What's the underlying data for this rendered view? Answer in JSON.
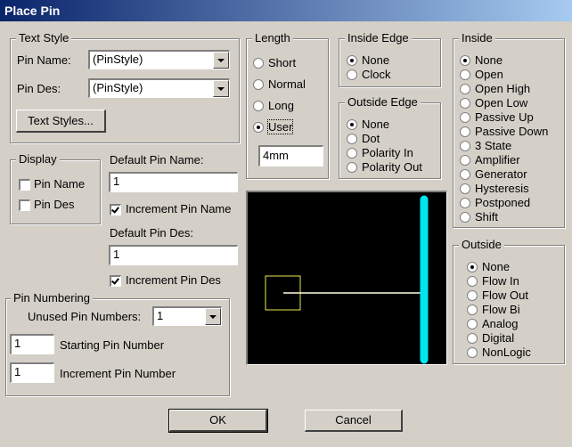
{
  "window": {
    "title": "Place Pin"
  },
  "text_style": {
    "legend": "Text Style",
    "pin_name_label": "Pin Name:",
    "pin_name_value": "(PinStyle)",
    "pin_des_label": "Pin Des:",
    "pin_des_value": "(PinStyle)",
    "text_styles_button": "Text Styles..."
  },
  "display": {
    "legend": "Display",
    "pin_name": {
      "label": "Pin Name",
      "checked": false
    },
    "pin_des": {
      "label": "Pin Des",
      "checked": false
    }
  },
  "defaults": {
    "default_pin_name_label": "Default Pin Name:",
    "default_pin_name_value": "1",
    "increment_pin_name": {
      "label": "Increment Pin Name",
      "checked": true
    },
    "default_pin_des_label": "Default Pin Des:",
    "default_pin_des_value": "1",
    "increment_pin_des": {
      "label": "Increment Pin Des",
      "checked": true
    }
  },
  "pin_numbering": {
    "legend": "Pin Numbering",
    "unused_label": "Unused Pin Numbers:",
    "unused_value": "1",
    "starting_value": "1",
    "starting_label": "Starting Pin Number",
    "increment_value": "1",
    "increment_label": "Increment Pin Number"
  },
  "length": {
    "legend": "Length",
    "options": [
      "Short",
      "Normal",
      "Long",
      "User"
    ],
    "selected": "User",
    "user_value": "4mm"
  },
  "inside_edge": {
    "legend": "Inside Edge",
    "options": [
      "None",
      "Clock"
    ],
    "selected": "None"
  },
  "outside_edge": {
    "legend": "Outside Edge",
    "options": [
      "None",
      "Dot",
      "Polarity In",
      "Polarity Out"
    ],
    "selected": "None"
  },
  "inside": {
    "legend": "Inside",
    "options": [
      "None",
      "Open",
      "Open High",
      "Open Low",
      "Passive Up",
      "Passive Down",
      "3 State",
      "Amplifier",
      "Generator",
      "Hysteresis",
      "Postponed",
      "Shift"
    ],
    "selected": "None"
  },
  "outside": {
    "legend": "Outside",
    "options": [
      "None",
      "Flow In",
      "Flow Out",
      "Flow Bi",
      "Analog",
      "Digital",
      "NonLogic"
    ],
    "selected": "None"
  },
  "buttons": {
    "ok": "OK",
    "cancel": "Cancel"
  },
  "colors": {
    "preview_bg": "#000000",
    "pin_body": "#00e5ee",
    "pin_line": "#ffffe0",
    "origin_box": "#e8e84a"
  }
}
